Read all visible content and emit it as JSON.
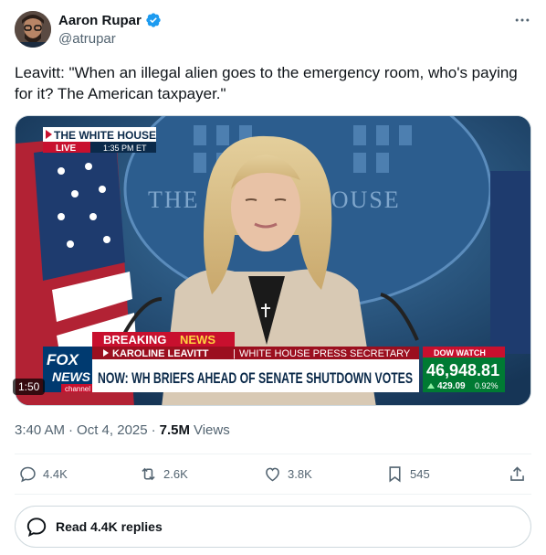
{
  "author": {
    "name": "Aaron Rupar",
    "handle": "@atrupar"
  },
  "tweet": {
    "text": "Leavitt: \"When an illegal alien goes to the emergency room, who's paying for it? The American taxpayer.\""
  },
  "video": {
    "duration": "1:50",
    "chyron": {
      "location": "THE WHITE HOUSE",
      "live_label": "LIVE",
      "time": "1:35 PM ET",
      "backdrop_text": "THE W    HOUSE",
      "breaking": "BREAKING",
      "news": "NEWS",
      "name_line": "KAROLINE LEAVITT",
      "title_line": "WHITE HOUSE PRESS SECRETARY",
      "headline": "NOW: WH BRIEFS AHEAD OF SENATE SHUTDOWN VOTES",
      "network_top": "FOX",
      "network_mid": "NEWS",
      "network_bottom": "channel",
      "ticker_label": "DOW WATCH",
      "ticker_value": "46,948.81",
      "ticker_change": "429.09",
      "ticker_pct": "0.92%"
    }
  },
  "meta": {
    "time": "3:40 AM",
    "separator": "·",
    "date": "Oct 4, 2025",
    "separator2": "·",
    "views_count": "7.5M",
    "views_label": "Views"
  },
  "actions": {
    "replies": "4.4K",
    "reposts": "2.6K",
    "likes": "3.8K",
    "bookmarks": "545"
  },
  "read_replies": "Read 4.4K replies",
  "colors": {
    "verified": "#1d9bf0",
    "muted": "#536471",
    "fox_red": "#c8102e",
    "fox_blue": "#003a70",
    "dow_green": "#007a33"
  }
}
